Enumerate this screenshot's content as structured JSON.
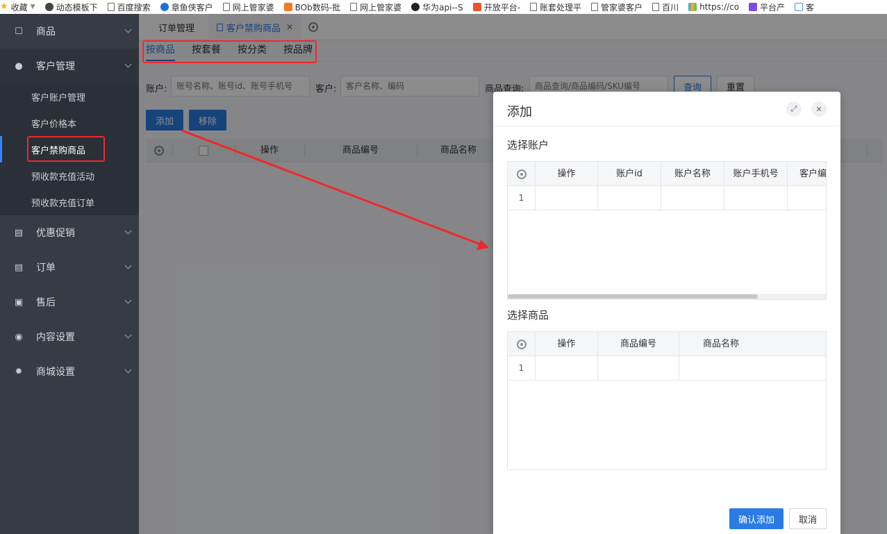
{
  "bookmarks": [
    {
      "label": "收藏",
      "icon": "star-icon"
    },
    {
      "label": "动态模板下",
      "icon": "face-icon"
    },
    {
      "label": "百度搜索",
      "icon": "doc-icon"
    },
    {
      "label": "章鱼侠客户",
      "icon": "globe-icon"
    },
    {
      "label": "网上管家婆",
      "icon": "doc-icon"
    },
    {
      "label": "BOb数码-批",
      "icon": "orange-icon"
    },
    {
      "label": "网上管家婆",
      "icon": "doc-icon"
    },
    {
      "label": "华为api--S",
      "icon": "dark-icon"
    },
    {
      "label": "开放平台-",
      "icon": "red-icon"
    },
    {
      "label": "账套处理平",
      "icon": "doc-icon"
    },
    {
      "label": "管家婆客户",
      "icon": "doc-icon"
    },
    {
      "label": "百川",
      "icon": "doc-icon"
    },
    {
      "label": "https://co",
      "icon": "multi-icon"
    },
    {
      "label": "平台产",
      "icon": "purple-icon"
    },
    {
      "label": "客",
      "icon": "box-icon"
    }
  ],
  "sidebar": {
    "groups": [
      {
        "label": "商品",
        "icon": "box-icon"
      },
      {
        "label": "客户管理",
        "icon": "user-icon"
      },
      {
        "label": "优惠促销",
        "icon": "list-icon"
      },
      {
        "label": "订单",
        "icon": "list-icon"
      },
      {
        "label": "售后",
        "icon": "clipboard-icon"
      },
      {
        "label": "内容设置",
        "icon": "eye-icon"
      },
      {
        "label": "商城设置",
        "icon": "gear-icon"
      }
    ],
    "customer_sub": [
      {
        "label": "客户账户管理"
      },
      {
        "label": "客户价格本"
      },
      {
        "label": "客户禁购商品"
      },
      {
        "label": "预收款充值活动"
      },
      {
        "label": "预收款充值订单"
      }
    ]
  },
  "page_tabs": [
    {
      "label": "订单管理"
    },
    {
      "label": "客户禁购商品"
    }
  ],
  "sub_tabs": [
    "按商品",
    "按套餐",
    "按分类",
    "按品牌"
  ],
  "filters": {
    "account_label": "账户:",
    "account_placeholder": "账号名称、账号id、账号手机号",
    "customer_label": "客户:",
    "customer_placeholder": "客户名称、编码",
    "product_label": "商品查询:",
    "product_placeholder": "商品查询/商品编码/SKU编号",
    "query_button": "查询",
    "reset_button": "重置"
  },
  "actions": {
    "add_button": "添加",
    "remove_button": "移除"
  },
  "main_table": {
    "columns": [
      "操作",
      "商品编号",
      "商品名称"
    ]
  },
  "modal": {
    "title": "添加",
    "account_section": {
      "title": "选择账户",
      "columns": [
        "操作",
        "账户id",
        "账户名称",
        "账户手机号",
        "客户编"
      ],
      "rows": [
        {
          "index": "1"
        }
      ]
    },
    "product_section": {
      "title": "选择商品",
      "columns": [
        "操作",
        "商品编号",
        "商品名称"
      ],
      "rows": [
        {
          "index": "1"
        }
      ]
    },
    "confirm_button": "确认添加",
    "cancel_button": "取消"
  },
  "colors": {
    "accent": "#2a7be4",
    "sidebar_bg": "#363b44",
    "annotation_red": "#f0282d"
  }
}
